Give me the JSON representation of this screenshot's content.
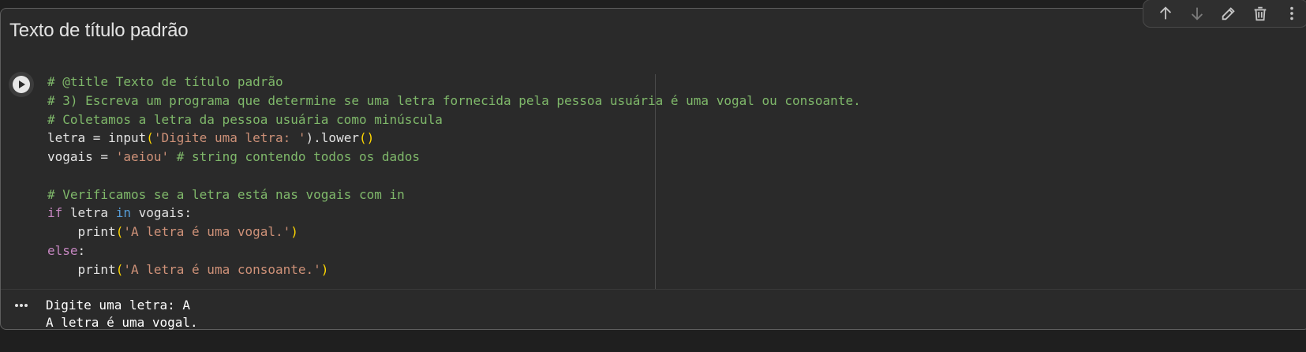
{
  "cell": {
    "title": "Texto de título padrão"
  },
  "code_lines": [
    [
      {
        "t": "# @title Texto de título padrão",
        "c": "comment"
      }
    ],
    [
      {
        "t": "# 3) Escreva um programa que determine se uma letra fornecida pela pessoa usuária é uma vogal ou consoante.",
        "c": "comment"
      }
    ],
    [
      {
        "t": "# Coletamos a letra da pessoa usuária como minúscula",
        "c": "comment"
      }
    ],
    [
      {
        "t": "letra = ",
        "c": "default"
      },
      {
        "t": "input",
        "c": "default"
      },
      {
        "t": "(",
        "c": "paren"
      },
      {
        "t": "'Digite uma letra: '",
        "c": "str"
      },
      {
        "t": ").lower",
        "c": "default"
      },
      {
        "t": "()",
        "c": "paren"
      }
    ],
    [
      {
        "t": "vogais = ",
        "c": "default"
      },
      {
        "t": "'aeiou'",
        "c": "str"
      },
      {
        "t": " # string contendo todos os dados",
        "c": "comment"
      }
    ],
    [
      {
        "t": "",
        "c": "default"
      }
    ],
    [
      {
        "t": "# Verificamos se a letra está nas vogais com in",
        "c": "comment"
      }
    ],
    [
      {
        "t": "if",
        "c": "kw"
      },
      {
        "t": " letra ",
        "c": "default"
      },
      {
        "t": "in",
        "c": "in"
      },
      {
        "t": " vogais:",
        "c": "default"
      }
    ],
    [
      {
        "t": "    print",
        "c": "default"
      },
      {
        "t": "(",
        "c": "paren"
      },
      {
        "t": "'A letra é uma vogal.'",
        "c": "str"
      },
      {
        "t": ")",
        "c": "paren"
      }
    ],
    [
      {
        "t": "else",
        "c": "kw"
      },
      {
        "t": ":",
        "c": "default"
      }
    ],
    [
      {
        "t": "    print",
        "c": "default"
      },
      {
        "t": "(",
        "c": "paren"
      },
      {
        "t": "'A letra é uma consoante.'",
        "c": "str"
      },
      {
        "t": ")",
        "c": "paren"
      }
    ]
  ],
  "output": {
    "line1": "Digite uma letra: A",
    "line2": "A letra é uma vogal."
  },
  "icons": {
    "run": "play-icon",
    "output_menu": "more-horizontal-icon",
    "move_up": "arrow-up-icon",
    "move_down": "arrow-down-icon",
    "edit": "pencil-icon",
    "delete": "trash-icon",
    "more": "more-vertical-icon"
  },
  "colors": {
    "comment": "#7fb86a",
    "string": "#ce9178",
    "keyword": "#c586c0",
    "in_keyword": "#569cd6",
    "paren": "#ffd700",
    "background": "#2a2a2a"
  }
}
